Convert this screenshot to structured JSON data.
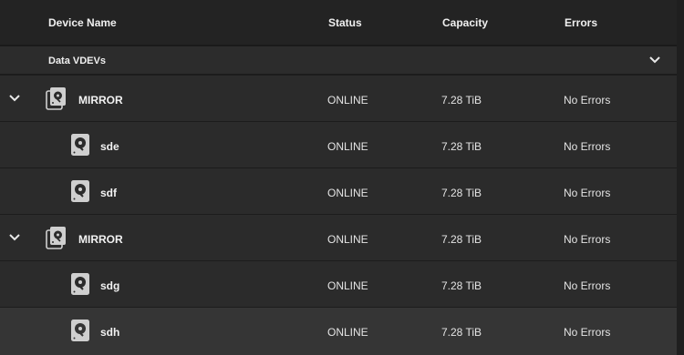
{
  "columns": {
    "device_name": "Device Name",
    "status": "Status",
    "capacity": "Capacity",
    "errors": "Errors"
  },
  "group": {
    "label": "Data VDEVs"
  },
  "rows": [
    {
      "name": "MIRROR",
      "status": "ONLINE",
      "capacity": "7.28 TiB",
      "errors": "No Errors",
      "type": "mirror",
      "expanded": true
    },
    {
      "name": "sde",
      "status": "ONLINE",
      "capacity": "7.28 TiB",
      "errors": "No Errors",
      "type": "disk"
    },
    {
      "name": "sdf",
      "status": "ONLINE",
      "capacity": "7.28 TiB",
      "errors": "No Errors",
      "type": "disk"
    },
    {
      "name": "MIRROR",
      "status": "ONLINE",
      "capacity": "7.28 TiB",
      "errors": "No Errors",
      "type": "mirror",
      "expanded": true
    },
    {
      "name": "sdg",
      "status": "ONLINE",
      "capacity": "7.28 TiB",
      "errors": "No Errors",
      "type": "disk"
    },
    {
      "name": "sdh",
      "status": "ONLINE",
      "capacity": "7.28 TiB",
      "errors": "No Errors",
      "type": "disk",
      "highlighted": true
    }
  ],
  "icons": {
    "expand": "chevron-down-icon",
    "mirror": "mirror-disks-icon",
    "disk": "hard-disk-icon"
  },
  "colors": {
    "background": "#282828",
    "header": "#232323",
    "row_highlight": "#353535",
    "text": "#e6e6e6"
  }
}
